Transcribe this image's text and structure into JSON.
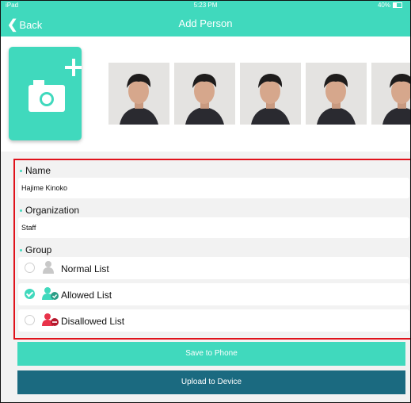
{
  "status_bar": {
    "carrier": "iPad",
    "time": "5:23 PM",
    "battery": "40%"
  },
  "nav": {
    "back_label": "Back",
    "title": "Add Person"
  },
  "photos": {
    "add_icon": "camera-plus-icon",
    "thumbnail_count": 5
  },
  "form": {
    "name": {
      "label": "Name",
      "value": "Hajime Kinoko"
    },
    "organization": {
      "label": "Organization",
      "value": "Staff"
    },
    "group": {
      "label": "Group",
      "options": [
        {
          "label": "Normal List",
          "selected": false,
          "icon_color": "#c8c8c8"
        },
        {
          "label": "Allowed List",
          "selected": true,
          "icon_color": "#40d9bd"
        },
        {
          "label": "Disallowed List",
          "selected": false,
          "icon_color": "#e8334a"
        }
      ]
    }
  },
  "buttons": {
    "save_label": "Save to Phone",
    "upload_label": "Upload to Device"
  },
  "colors": {
    "accent": "#40d9bd",
    "upload": "#1b6a80",
    "highlight_border": "#e0121b"
  }
}
